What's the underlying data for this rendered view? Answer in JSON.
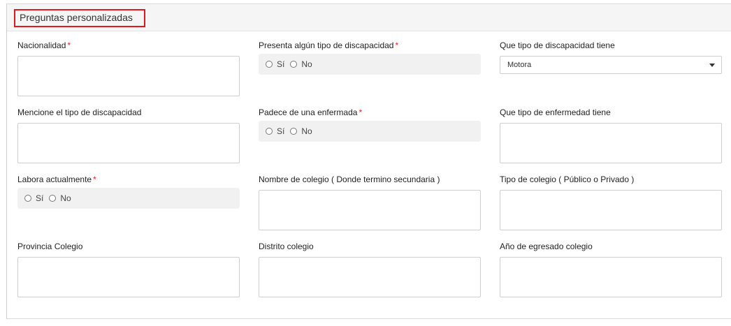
{
  "panel": {
    "title": "Preguntas personalizadas"
  },
  "required_mark": "*",
  "fields": {
    "nacionalidad": {
      "label": "Nacionalidad"
    },
    "discapacidad": {
      "label": "Presenta algún tipo de discapacidad",
      "options": [
        "Sí",
        "No"
      ]
    },
    "tipo_discapacidad": {
      "label": "Que tipo de discapacidad tiene",
      "value": "Motora"
    },
    "mencione_discapacidad": {
      "label": "Mencione el tipo de discapacidad"
    },
    "enfermedad": {
      "label": "Padece de una enfermada",
      "options": [
        "Sí",
        "No"
      ]
    },
    "tipo_enfermedad": {
      "label": "Que tipo de enfermedad tiene"
    },
    "labora": {
      "label": "Labora actualmente",
      "options": [
        "Sí",
        "No"
      ]
    },
    "nombre_colegio": {
      "label": "Nombre de colegio ( Donde termino secundaria )"
    },
    "tipo_colegio": {
      "label": "Tipo de colegio ( Público o Privado )"
    },
    "provincia_colegio": {
      "label": "Provincia Colegio"
    },
    "distrito_colegio": {
      "label": "Distrito colegio"
    },
    "anio_egresado": {
      "label": "Año de egresado colegio"
    }
  }
}
